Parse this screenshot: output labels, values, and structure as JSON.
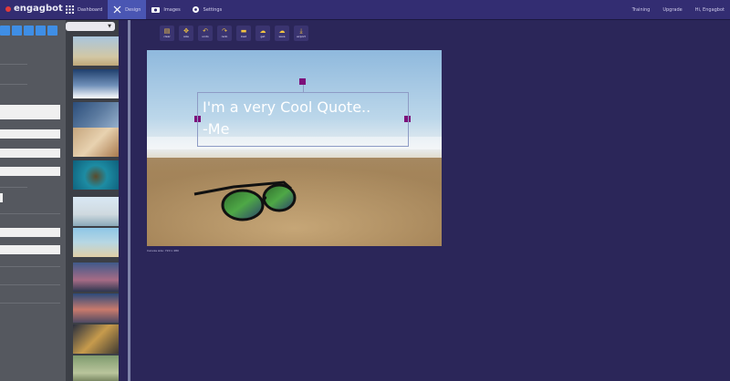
{
  "app": {
    "logo_text": "engagbot"
  },
  "nav": {
    "items": [
      {
        "label": "Dashboard",
        "icon": "grid-icon"
      },
      {
        "label": "Design",
        "icon": "tools-icon"
      },
      {
        "label": "Images",
        "icon": "camera-icon"
      },
      {
        "label": "Settings",
        "icon": "gear-icon"
      }
    ],
    "active": "Design"
  },
  "top_right": {
    "link1": "Training",
    "link2": "Upgrade",
    "link3": "Hi, Engagbot"
  },
  "toolbar": {
    "buttons": [
      {
        "icon": "clear-icon",
        "label": "clear"
      },
      {
        "icon": "move-icon",
        "label": "size"
      },
      {
        "icon": "undo-icon",
        "label": "undo"
      },
      {
        "icon": "redo-icon",
        "label": "redo"
      },
      {
        "icon": "folder-icon",
        "label": "load"
      },
      {
        "icon": "cloud-upload-icon",
        "label": "get"
      },
      {
        "icon": "cloud-save-icon",
        "label": "save"
      },
      {
        "icon": "download-icon",
        "label": "export"
      }
    ]
  },
  "canvas": {
    "quote_line1": "I'm a very Cool Quote..",
    "quote_line2": "-Me",
    "caption": "Canvas size: 720 x 480"
  },
  "colors": {
    "background": "#2b2659",
    "topbar": "#332d72",
    "active_nav": "#4a56b3",
    "handle": "#7d0f7a",
    "toolbar_icon": "#f4c542",
    "tool_swatch": "#3f8ee5"
  }
}
